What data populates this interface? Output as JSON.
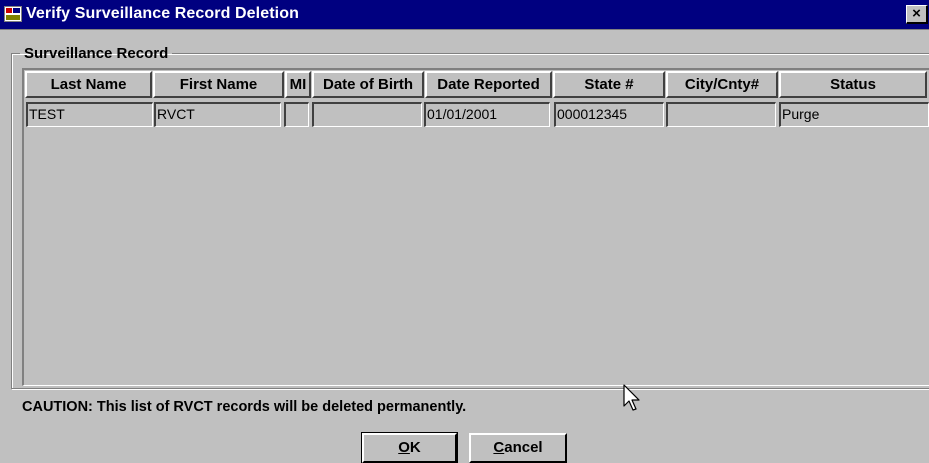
{
  "window": {
    "title": "Verify Surveillance Record Deletion",
    "close_glyph": "×"
  },
  "group": {
    "label": "Surveillance Record"
  },
  "table": {
    "columns": [
      "Last Name",
      "First Name",
      "MI",
      "Date of Birth",
      "Date Reported",
      "State #",
      "City/Cnty#",
      "Status"
    ],
    "rows": [
      [
        "TEST",
        "RVCT",
        "",
        "",
        "01/01/2001",
        "000012345",
        "",
        "Purge"
      ]
    ]
  },
  "caution": "CAUTION: This list of RVCT records will be deleted permanently.",
  "buttons": {
    "ok": {
      "mnemonic": "O",
      "rest": "K"
    },
    "cancel": {
      "mnemonic": "C",
      "rest": "ancel"
    }
  },
  "colors": {
    "titlebar": "#000080",
    "face": "#c0c0c0"
  },
  "icons": {
    "app": "app-icon",
    "close": "close-icon",
    "cursor": "mouse-pointer-icon"
  }
}
